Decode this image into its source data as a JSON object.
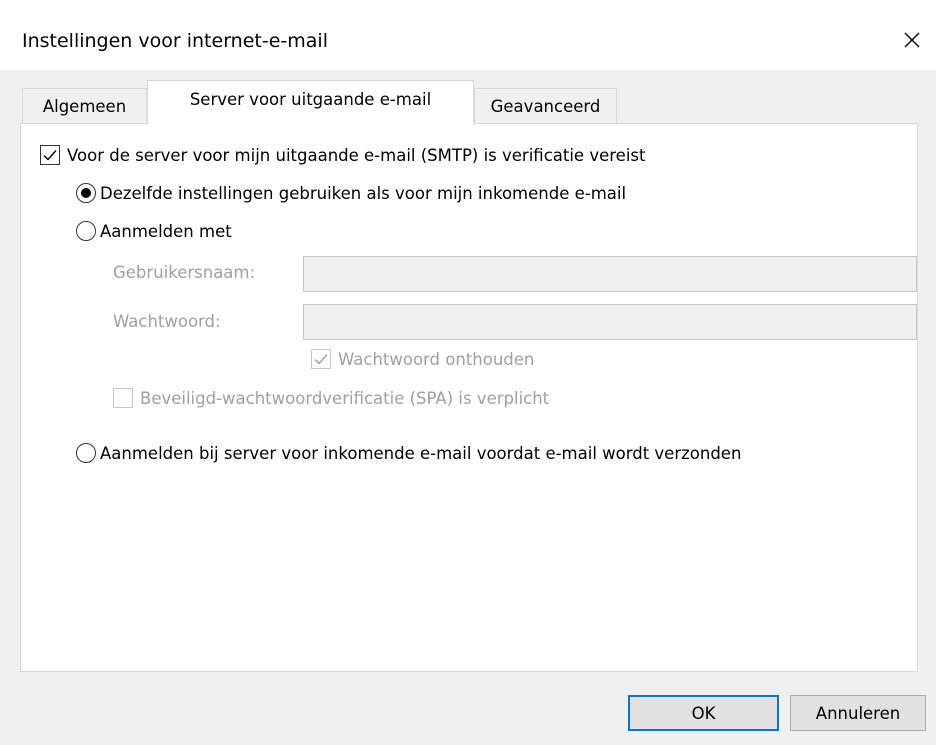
{
  "window": {
    "title": "Instellingen voor internet-e-mail"
  },
  "tabs": [
    {
      "label": "Algemeen",
      "active": false
    },
    {
      "label": "Server voor uitgaande e-mail",
      "active": true
    },
    {
      "label": "Geavanceerd",
      "active": false
    }
  ],
  "smtp_auth": {
    "label": "Voor de server voor mijn uitgaande e-mail (SMTP) is verificatie vereist",
    "checked": true
  },
  "options": {
    "same_settings": {
      "label": "Dezelfde instellingen gebruiken als voor mijn inkomende e-mail",
      "selected": true
    },
    "login_with": {
      "label": "Aanmelden met",
      "selected": false
    },
    "login_incoming": {
      "label": "Aanmelden bij server voor inkomende e-mail voordat e-mail wordt verzonden",
      "selected": false
    }
  },
  "credentials": {
    "username_label": "Gebruikersnaam:",
    "username_value": "",
    "password_label": "Wachtwoord:",
    "password_value": "",
    "remember_label": "Wachtwoord onthouden",
    "remember_checked": true,
    "spa_label": "Beveiligd-wachtwoordverificatie (SPA) is verplicht",
    "spa_checked": false
  },
  "buttons": {
    "ok": "OK",
    "cancel": "Annuleren"
  },
  "colors": {
    "accent": "#0078d7",
    "disabled_text": "#a0a0a0"
  }
}
